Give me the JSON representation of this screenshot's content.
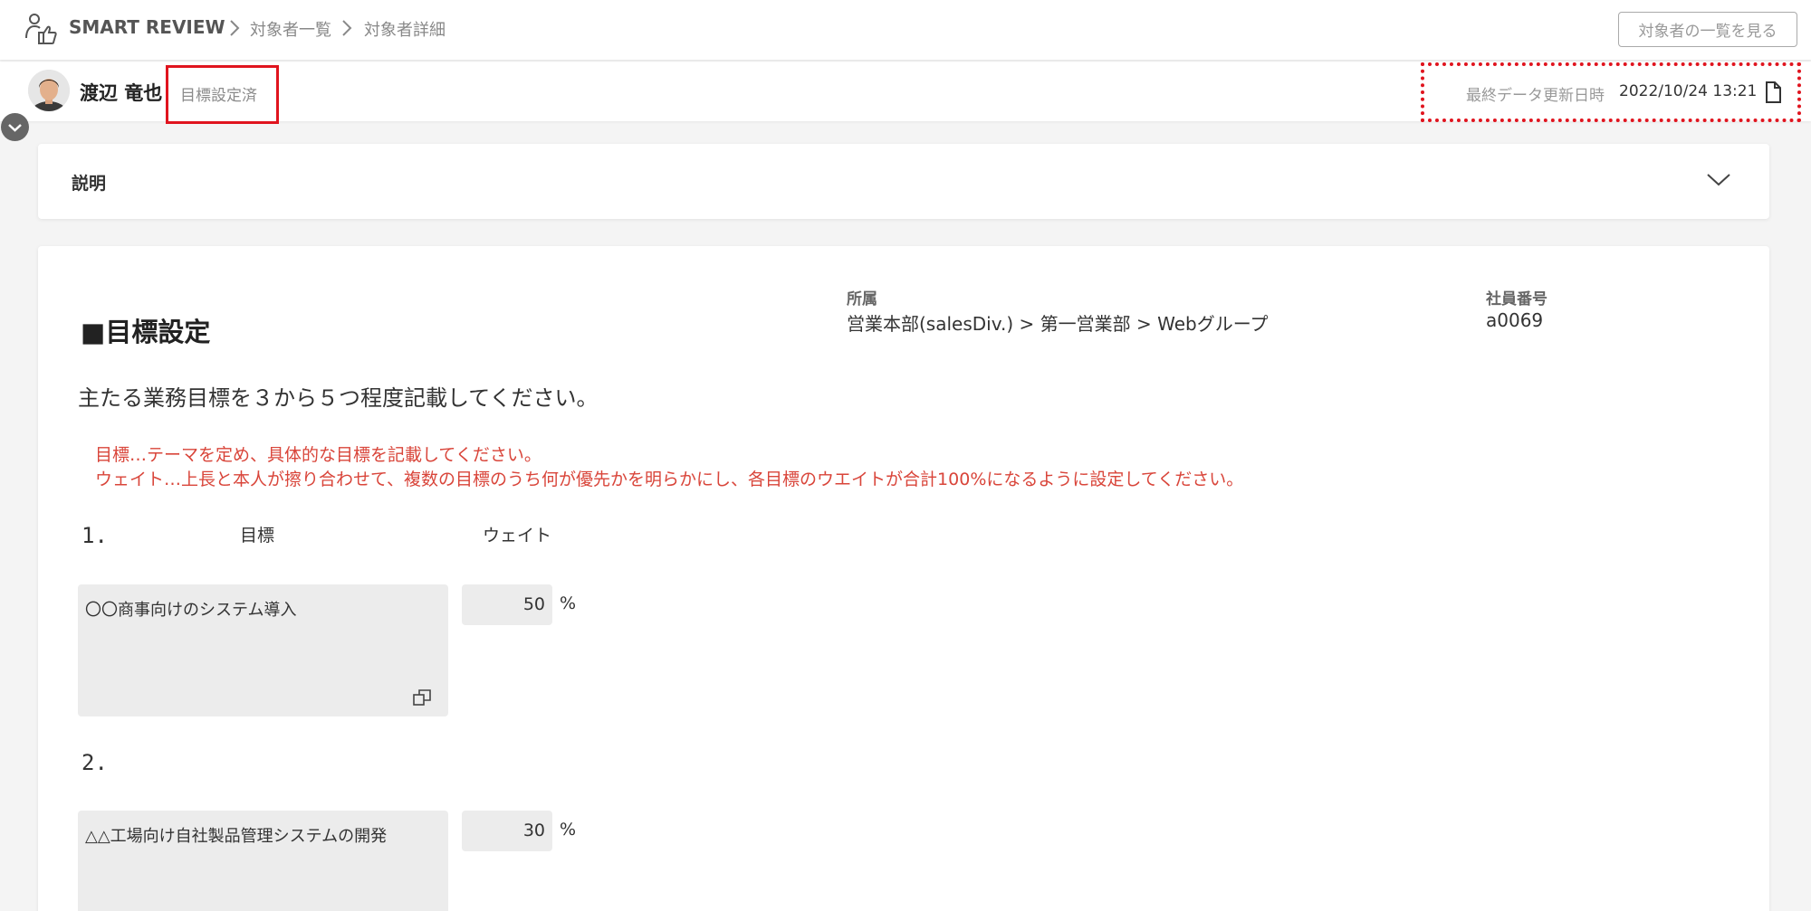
{
  "header": {
    "brand": "SMART REVIEW",
    "breadcrumbs": [
      "対象者一覧",
      "対象者詳細"
    ],
    "list_button": "対象者の一覧を見る"
  },
  "user": {
    "name": "渡辺 竜也",
    "status": "目標設定済",
    "update_label": "最終データ更新日時",
    "update_value": "2022/10/24 13:21"
  },
  "description": {
    "title": "説明"
  },
  "main": {
    "section_title": "■目標設定",
    "affiliation_label": "所属",
    "affiliation_value": "営業本部(salesDiv.) > 第一営業部 > Webグループ",
    "employee_label": "社員番号",
    "employee_value": "a0069",
    "instruction": "主たる業務目標を３から５つ程度記載してください。",
    "notes": [
      "目標…テーマを定め、具体的な目標を記載してください。",
      "ウェイト…上長と本人が擦り合わせて、複数の目標のうち何が優先かを明らかにし、各目標のウエイトが合計100%になるように設定してください。"
    ],
    "col_goal": "目標",
    "col_weight": "ウェイト",
    "percent_symbol": "%",
    "goals": [
      {
        "number": "1.",
        "text": "〇〇商事向けのシステム導入",
        "weight": "50"
      },
      {
        "number": "2.",
        "text": "△△工場向け自社製品管理システムの開発",
        "weight": "30"
      }
    ]
  },
  "colors": {
    "highlight": "#e0141e",
    "note_red": "#d9453a",
    "input_bg": "#ececec"
  },
  "icons": [
    "user-thumbs-up-icon",
    "chevron-right-icon",
    "document-icon",
    "chevron-down-icon",
    "expand-icon"
  ]
}
